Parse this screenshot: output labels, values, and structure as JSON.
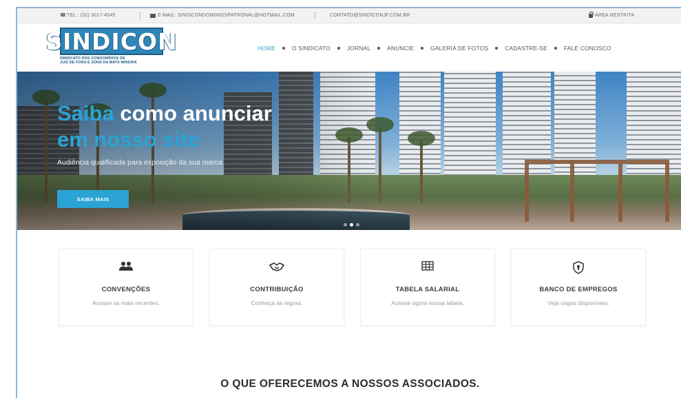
{
  "topbar": {
    "phone": "TEL.: (32) 3017-4545",
    "email": "E-MAIL: SINDICONDOMINIOSPATRONAL@HOTMAIL.COM",
    "contact": "CONTATO@SINDICONJF.COM.BR",
    "restricted": "ÁREA RESTRITA"
  },
  "logo": {
    "word": "SINDICON",
    "sub_line1": "SINDICATO DOS CONDOMÍNIOS DE",
    "sub_line2": "JUIZ DE FORA E ZONA DA MATA MINEIRA",
    "color": "#2f86b8"
  },
  "nav": {
    "items": [
      "HOME",
      "O SINDICATO",
      "JORNAL",
      "ANUNCIE",
      "GALERIA DE FOTOS",
      "CADASTRE-SE",
      "FALE CONOSCO"
    ],
    "active": "HOME",
    "active_color": "#2ba3d4"
  },
  "hero": {
    "title_hl1": "Saiba",
    "title_rest1": " como anunciar",
    "title_hl2": "em nosso site",
    "subtitle": "Audiência qualificada para exposição da sua marca",
    "button": "SAIBA MAIS",
    "accent": "#2ba3d4",
    "slide_count": 3,
    "active_slide": 2
  },
  "cards": [
    {
      "icon": "users-icon",
      "title": "CONVENÇÕES",
      "desc": "Acesse as mais recentes."
    },
    {
      "icon": "handshake-icon",
      "title": "CONTRIBUIÇÃO",
      "desc": "Conheça as regras."
    },
    {
      "icon": "table-icon",
      "title": "TABELA SALARIAL",
      "desc": "Acesse agora nossa tabela."
    },
    {
      "icon": "shield-icon",
      "title": "BANCO DE EMPREGOS",
      "desc": "Veja vagas disponíveis."
    }
  ],
  "section_title": "O QUE OFERECEMOS A NOSSOS ASSOCIADOS."
}
